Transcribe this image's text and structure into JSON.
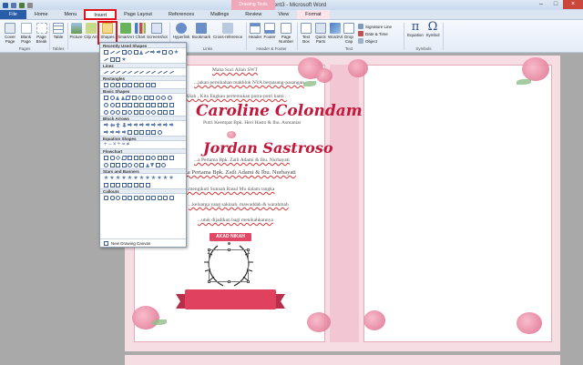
{
  "window": {
    "title": "Document3 - Microsoft Word",
    "context_tab_group": "Drawing Tools"
  },
  "tabs": [
    {
      "label": "File"
    },
    {
      "label": "Home"
    },
    {
      "label": "Menu"
    },
    {
      "label": "Insert"
    },
    {
      "label": "Page Layout"
    },
    {
      "label": "References"
    },
    {
      "label": "Mailings"
    },
    {
      "label": "Review"
    },
    {
      "label": "View"
    },
    {
      "label": "Format"
    }
  ],
  "ribbon": {
    "pages": {
      "cover_page": "Cover Page",
      "blank_page": "Blank Page",
      "page_break": "Page Break",
      "group": "Pages"
    },
    "tables": {
      "table": "Table",
      "group": "Tables"
    },
    "illustrations": {
      "picture": "Picture",
      "clip_art": "Clip Art",
      "shapes": "Shapes",
      "smartart": "SmartArt",
      "chart": "Chart",
      "screenshot": "Screenshot"
    },
    "links": {
      "hyperlink": "Hyperlink",
      "bookmark": "Bookmark",
      "cross_reference": "Cross-reference",
      "group": "Links"
    },
    "header_footer": {
      "header": "Header",
      "footer": "Footer",
      "page_number": "Page Number",
      "group": "Header & Footer"
    },
    "text": {
      "text_box": "Text Box",
      "quick_parts": "Quick Parts",
      "wordart": "WordArt",
      "drop_cap": "Drop Cap",
      "signature_line": "Signature Line",
      "date_time": "Date & Time",
      "object": "Object",
      "group": "Text"
    },
    "symbols": {
      "equation": "Equation",
      "symbol": "Symbol",
      "group": "Symbols"
    }
  },
  "shapes_menu": {
    "sections": [
      "Recently Used Shapes",
      "Lines",
      "Rectangles",
      "Basic Shapes",
      "Block Arrows",
      "Equation Shapes",
      "Flowchart",
      "Stars and Banners",
      "Callouts"
    ],
    "new_canvas": "New Drawing Canvas"
  },
  "document": {
    "line1": "Maha Suci Allah SWT",
    "line2": "...jakan pernikahan makhluk NYA berpasang-pasangan",
    "line3": "...Allah , Kita Engkau pertemukan putra-putri kami :",
    "bride_name": "Caroline Colondam",
    "bride_parents": "Putri Keempat Bpk. Heri Hasto & Ibu. Asmaniar",
    "groom_name": "Jordan Sastroso",
    "groom_parents": "...a Pertama Bpk. Zaili Adami & Ibu. Nurhayati",
    "line4": "...a Pertama Bpk. Zaili Adami & Ibu. Nurhayati",
    "line5": "...mengikuti Sunnah Rasul Mu dalam rangka",
    "line6": "...keluarga yang sakinah, mawaddah & warahmah",
    "line7": "...utuk dijadikan bagi menikahkannya",
    "akad_label": "AKAD NIKAH"
  }
}
